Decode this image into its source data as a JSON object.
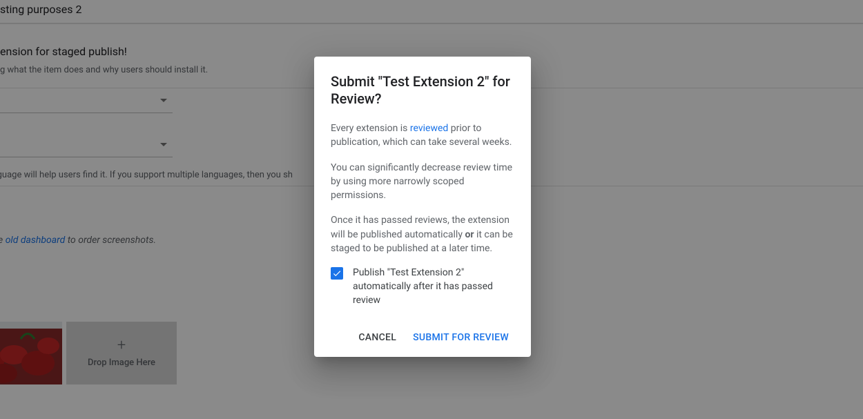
{
  "bg": {
    "title_fragment": "sting purposes 2",
    "heading_fragment": "ension for staged publish!",
    "helper_fragment": "g what the item does and why users should install it.",
    "lang_note_fragment": "n's language will help users find it. If you support multiple languages, then you sh",
    "screenshot_note_prefix": "use the ",
    "screenshot_note_link": "old dashboard",
    "screenshot_note_suffix": " to order screenshots.",
    "dropzone_label": "Drop Image Here"
  },
  "dialog": {
    "title": "Submit \"Test Extension 2\" for Review?",
    "p1_a": "Every extension is ",
    "p1_link": "reviewed",
    "p1_b": " prior to publication, which can take several weeks.",
    "p2": "You can significantly decrease review time by using more narrowly scoped permissions.",
    "p3_a": "Once it has passed reviews, the extension will be published automatically ",
    "p3_strong": "or",
    "p3_b": " it can be staged to be published at a later time.",
    "checkbox_label": "Publish \"Test Extension 2\" automatically after it has passed review",
    "checkbox_checked": true,
    "cancel": "Cancel",
    "submit": "Submit for Review"
  }
}
